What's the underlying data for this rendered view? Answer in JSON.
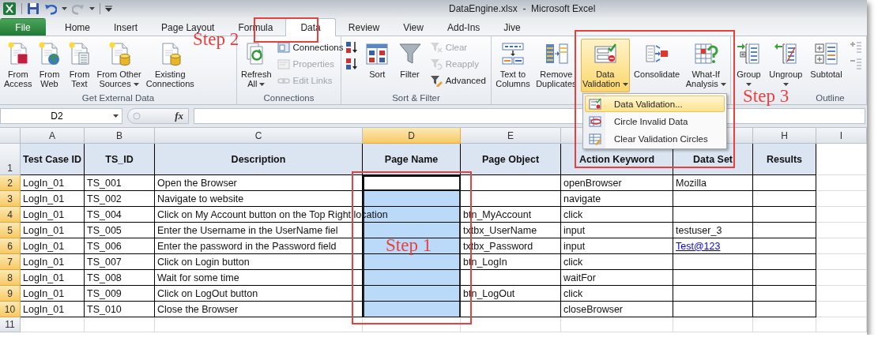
{
  "window": {
    "title": "DataEngine.xlsx  -  Microsoft Excel"
  },
  "ribbon_tabs": [
    {
      "label": "File",
      "kind": "file",
      "selected": false
    },
    {
      "label": "Home",
      "kind": "tab",
      "selected": false
    },
    {
      "label": "Insert",
      "kind": "tab",
      "selected": false
    },
    {
      "label": "Page Layout",
      "kind": "tab",
      "selected": false
    },
    {
      "label": "Formula",
      "kind": "tab",
      "selected": false
    },
    {
      "label": "Data",
      "kind": "tab",
      "selected": true
    },
    {
      "label": "Review",
      "kind": "tab",
      "selected": false
    },
    {
      "label": "View",
      "kind": "tab",
      "selected": false
    },
    {
      "label": "Add-Ins",
      "kind": "tab",
      "selected": false
    },
    {
      "label": "Jive",
      "kind": "tab",
      "selected": false
    }
  ],
  "ribbon_groups": [
    {
      "label": "Get External Data",
      "items": [
        {
          "kind": "large",
          "lines": [
            "From",
            "Access"
          ],
          "dropdown": false,
          "pressed": false
        },
        {
          "kind": "large",
          "lines": [
            "From",
            "Web"
          ],
          "dropdown": false,
          "pressed": false
        },
        {
          "kind": "large",
          "lines": [
            "From",
            "Text"
          ],
          "dropdown": false,
          "pressed": false
        },
        {
          "kind": "large",
          "lines": [
            "From Other",
            "Sources"
          ],
          "dropdown": true,
          "pressed": false
        },
        {
          "kind": "large",
          "lines": [
            "Existing",
            "Connections"
          ],
          "dropdown": false,
          "pressed": false
        }
      ]
    },
    {
      "label": "Connections",
      "items": [
        {
          "kind": "large",
          "lines": [
            "Refresh",
            "All"
          ],
          "dropdown": true,
          "pressed": false
        },
        {
          "kind": "column",
          "buttons": [
            {
              "kind": "small",
              "label": "Connections",
              "disabled": false
            },
            {
              "kind": "small",
              "label": "Properties",
              "disabled": true
            },
            {
              "kind": "small",
              "label": "Edit Links",
              "disabled": true
            }
          ]
        }
      ]
    },
    {
      "label": "Sort & Filter",
      "items": [
        {
          "kind": "column",
          "buttons": [
            {
              "kind": "icon"
            },
            {
              "kind": "icon"
            }
          ]
        },
        {
          "kind": "large",
          "lines": [
            "Sort"
          ],
          "dropdown": false,
          "pressed": false
        },
        {
          "kind": "large",
          "lines": [
            "Filter"
          ],
          "dropdown": false,
          "pressed": false
        },
        {
          "kind": "column",
          "buttons": [
            {
              "kind": "small",
              "label": "Clear",
              "disabled": true
            },
            {
              "kind": "small",
              "label": "Reapply",
              "disabled": true
            },
            {
              "kind": "small",
              "label": "Advanced",
              "disabled": false
            }
          ]
        }
      ]
    },
    {
      "items": [
        {
          "kind": "large",
          "lines": [
            "Text to",
            "Columns"
          ],
          "dropdown": false,
          "pressed": false
        },
        {
          "kind": "large",
          "lines": [
            "Remove",
            "Duplicates"
          ],
          "dropdown": false,
          "pressed": false
        },
        {
          "kind": "large",
          "lines": [
            "Data",
            "Validation"
          ],
          "dropdown": true,
          "pressed": true
        },
        {
          "kind": "large",
          "lines": [
            "Consolidate"
          ],
          "dropdown": false,
          "pressed": false
        },
        {
          "kind": "large",
          "lines": [
            "What-If",
            "Analysis"
          ],
          "dropdown": true,
          "pressed": false
        }
      ]
    },
    {
      "label": "Outline",
      "items": [
        {
          "kind": "large",
          "lines": [
            "Group"
          ],
          "dropdown": true,
          "pressed": false
        },
        {
          "kind": "large",
          "lines": [
            "Ungroup"
          ],
          "dropdown": true,
          "pressed": false
        },
        {
          "kind": "large",
          "lines": [
            "Subtotal"
          ],
          "dropdown": false,
          "pressed": false
        },
        {
          "kind": "column",
          "buttons": [
            {
              "kind": "icon"
            },
            {
              "kind": "icon"
            }
          ]
        }
      ]
    }
  ],
  "dropdown_menu": {
    "items": [
      {
        "label": "Data Validation...",
        "selected": true
      },
      {
        "label": "Circle Invalid Data",
        "selected": false
      },
      {
        "label": "Clear Validation Circles",
        "selected": false
      }
    ]
  },
  "formula_bar": {
    "name_box": "D2",
    "function_button": "fx"
  },
  "columns": [
    {
      "label": "A",
      "selected": false
    },
    {
      "label": "B",
      "selected": false
    },
    {
      "label": "C",
      "selected": false
    },
    {
      "label": "D",
      "selected": true
    },
    {
      "label": "E",
      "selected": false
    },
    {
      "selected": false
    },
    {
      "selected": false
    },
    {
      "label": "H",
      "selected": false
    },
    {
      "label": "I",
      "selected": false
    }
  ],
  "header_row": {
    "number": "1",
    "cells": [
      "Test Case ID",
      "TS_ID",
      "Description",
      "Page Name",
      "Page Object",
      "Action Keyword",
      "Data Set",
      "Results"
    ]
  },
  "rows": [
    {
      "number": "2",
      "selected": true,
      "active": true,
      "cells": [
        "LogIn_01",
        "TS_001",
        "Open the Browser",
        "",
        "",
        "openBrowser",
        "Mozilla",
        ""
      ]
    },
    {
      "number": "3",
      "selected": true,
      "active": false,
      "cells": [
        "LogIn_01",
        "TS_002",
        "Navigate to website",
        "",
        "",
        "navigate",
        "",
        ""
      ]
    },
    {
      "number": "4",
      "selected": true,
      "active": false,
      "cells": [
        "LogIn_01",
        "TS_004",
        "Click on My Account button on the Top Right location",
        "",
        "btn_MyAccount",
        "click",
        "",
        ""
      ]
    },
    {
      "number": "5",
      "selected": true,
      "active": false,
      "cells": [
        "LogIn_01",
        "TS_005",
        "Enter the Username in the UserName fiel",
        "",
        "txtbx_UserName",
        "input",
        "testuser_3",
        ""
      ]
    },
    {
      "number": "6",
      "selected": true,
      "active": false,
      "cells": [
        "LogIn_01",
        "TS_006",
        "Enter the password in the Password field",
        "",
        "txtbx_Password",
        "input",
        {
          "text": "Test@123",
          "kind": "link"
        },
        ""
      ]
    },
    {
      "number": "7",
      "selected": true,
      "active": false,
      "cells": [
        "LogIn_01",
        "TS_007",
        "Click on Login button",
        "",
        "btn_LogIn",
        "click",
        "",
        ""
      ]
    },
    {
      "number": "8",
      "selected": true,
      "active": false,
      "cells": [
        "LogIn_01",
        "TS_008",
        "Wait for some time",
        "",
        "",
        "waitFor",
        "",
        ""
      ]
    },
    {
      "number": "9",
      "selected": true,
      "active": false,
      "cells": [
        "LogIn_01",
        "TS_009",
        "Click on LogOut button",
        "",
        "btn_LogOut",
        "click",
        "",
        ""
      ]
    },
    {
      "number": "10",
      "selected": true,
      "active": false,
      "cells": [
        "LogIn_01",
        "TS_010",
        "Close the Browser",
        "",
        "",
        "closeBrowser",
        "",
        ""
      ]
    }
  ],
  "empty_row": {
    "number": "11"
  },
  "annotations": [
    {
      "label": "Step 2"
    },
    {
      "label": "Step 3"
    },
    {
      "label": "Step 1"
    }
  ]
}
